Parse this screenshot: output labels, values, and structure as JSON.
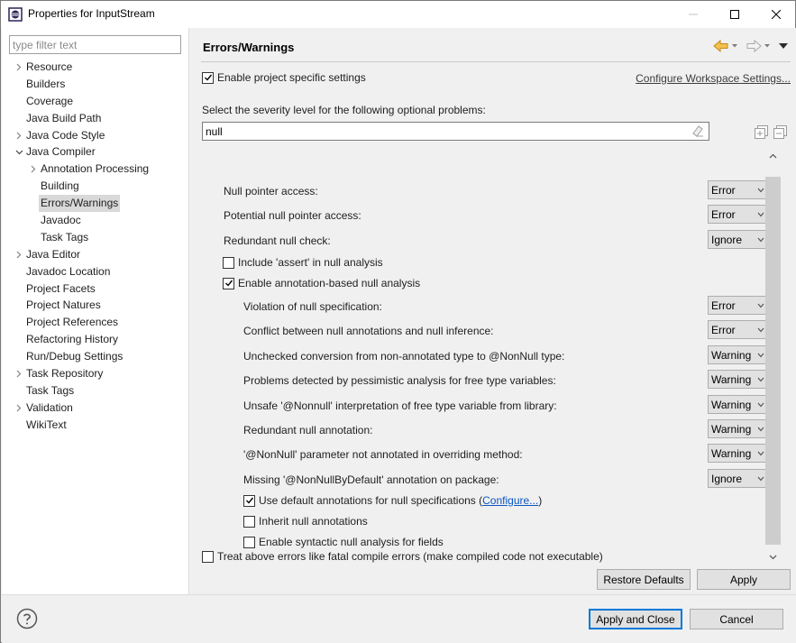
{
  "window": {
    "title": "Properties for InputStream"
  },
  "filter": {
    "placeholder": "type filter text"
  },
  "tree": [
    {
      "label": "Resource",
      "level": 0,
      "expander": "collapsed"
    },
    {
      "label": "Builders",
      "level": 0,
      "expander": "none"
    },
    {
      "label": "Coverage",
      "level": 0,
      "expander": "none"
    },
    {
      "label": "Java Build Path",
      "level": 0,
      "expander": "none"
    },
    {
      "label": "Java Code Style",
      "level": 0,
      "expander": "collapsed"
    },
    {
      "label": "Java Compiler",
      "level": 0,
      "expander": "expanded"
    },
    {
      "label": "Annotation Processing",
      "level": 1,
      "expander": "collapsed"
    },
    {
      "label": "Building",
      "level": 1,
      "expander": "none"
    },
    {
      "label": "Errors/Warnings",
      "level": 1,
      "expander": "none",
      "selected": true
    },
    {
      "label": "Javadoc",
      "level": 1,
      "expander": "none"
    },
    {
      "label": "Task Tags",
      "level": 1,
      "expander": "none"
    },
    {
      "label": "Java Editor",
      "level": 0,
      "expander": "collapsed"
    },
    {
      "label": "Javadoc Location",
      "level": 0,
      "expander": "none"
    },
    {
      "label": "Project Facets",
      "level": 0,
      "expander": "none"
    },
    {
      "label": "Project Natures",
      "level": 0,
      "expander": "none"
    },
    {
      "label": "Project References",
      "level": 0,
      "expander": "none"
    },
    {
      "label": "Refactoring History",
      "level": 0,
      "expander": "none"
    },
    {
      "label": "Run/Debug Settings",
      "level": 0,
      "expander": "none"
    },
    {
      "label": "Task Repository",
      "level": 0,
      "expander": "collapsed"
    },
    {
      "label": "Task Tags",
      "level": 0,
      "expander": "none"
    },
    {
      "label": "Validation",
      "level": 0,
      "expander": "collapsed"
    },
    {
      "label": "WikiText",
      "level": 0,
      "expander": "none"
    }
  ],
  "page": {
    "title": "Errors/Warnings",
    "enable_project_specific": {
      "label": "Enable project specific settings",
      "checked": true
    },
    "configure_workspace_link": "Configure Workspace Settings...",
    "severity_prompt": "Select the severity level for the following optional problems:",
    "search_value": "null"
  },
  "options": {
    "null_pointer": {
      "label": "Null pointer access:",
      "value": "Error"
    },
    "potential_null": {
      "label": "Potential null pointer access:",
      "value": "Error"
    },
    "redundant_check": {
      "label": "Redundant null check:",
      "value": "Ignore"
    },
    "include_assert": {
      "label": "Include 'assert' in null analysis",
      "checked": false
    },
    "enable_annotation": {
      "label": "Enable annotation-based null analysis",
      "checked": true
    },
    "violation": {
      "label": "Violation of null specification:",
      "value": "Error"
    },
    "conflict": {
      "label": "Conflict between null annotations and null inference:",
      "value": "Error"
    },
    "unchecked": {
      "label": "Unchecked conversion from non-annotated type to @NonNull type:",
      "value": "Warning"
    },
    "pessimistic": {
      "label": "Problems detected by pessimistic analysis for free type variables:",
      "value": "Warning"
    },
    "unsafe": {
      "label": "Unsafe '@Nonnull' interpretation of free type variable from library:",
      "value": "Warning"
    },
    "redundant_annotation": {
      "label": "Redundant null annotation:",
      "value": "Warning"
    },
    "nonnull_param": {
      "label": "'@NonNull' parameter not annotated in overriding method:",
      "value": "Warning"
    },
    "missing_default": {
      "label": "Missing '@NonNullByDefault' annotation on package:",
      "value": "Ignore"
    },
    "use_default": {
      "label_before": "Use default annotations for null specifications (",
      "link": "Configure...",
      "label_after": ")",
      "checked": true
    },
    "inherit": {
      "label": "Inherit null annotations",
      "checked": false
    },
    "syntactic": {
      "label": "Enable syntactic null analysis for fields",
      "checked": false
    }
  },
  "treat_fatal": {
    "label": "Treat above errors like fatal compile errors (make compiled code not executable)",
    "checked": false
  },
  "buttons": {
    "restore_defaults": "Restore Defaults",
    "apply": "Apply",
    "apply_and_close": "Apply and Close",
    "cancel": "Cancel"
  },
  "icons": {
    "help": "help-icon",
    "back": "back-arrow-icon",
    "forward": "forward-arrow-icon",
    "menu": "view-menu-icon",
    "expand_all": "expand-all-icon",
    "collapse_all": "collapse-all-icon",
    "clear": "clear-eraser-icon"
  },
  "colors": {
    "nav_back": "#e8a33a",
    "selection": "#d9d9d9",
    "link": "#0a56c2"
  }
}
